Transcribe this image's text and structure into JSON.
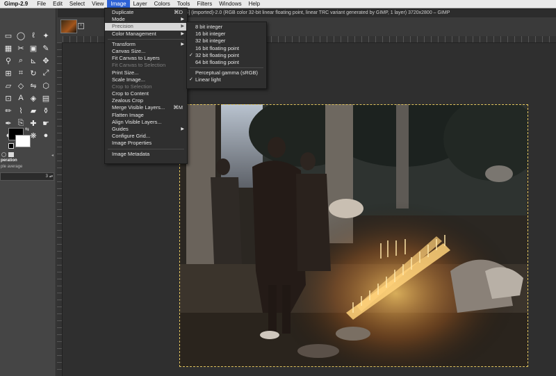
{
  "menubar": {
    "app_name": "Gimp-2.9",
    "items": [
      "File",
      "Edit",
      "Select",
      "View",
      "Image",
      "Layer",
      "Colors",
      "Tools",
      "Filters",
      "Windows",
      "Help"
    ],
    "active": "Image"
  },
  "window": {
    "title": "*[_5014835] (imported)-2.0 (RGB color 32-bit linear floating point, linear TRC variant generated by GIMP, 1 layer) 3720x2800 – GIMP"
  },
  "toolbox": {
    "tools": [
      "rect-select-icon",
      "ellipse-select-icon",
      "free-select-icon",
      "fuzzy-select-icon",
      "select-by-color-icon",
      "scissors-icon",
      "foreground-select-icon",
      "paths-icon",
      "color-picker-icon",
      "zoom-icon",
      "measure-icon",
      "move-icon",
      "align-icon",
      "crop-icon",
      "rotate-icon",
      "scale-icon",
      "shear-icon",
      "perspective-icon",
      "flip-icon",
      "cage-icon",
      "unified-transform-icon",
      "text-icon",
      "bucket-fill-icon",
      "blend-icon",
      "pencil-icon",
      "paintbrush-icon",
      "eraser-icon",
      "airbrush-icon",
      "ink-icon",
      "clone-icon",
      "heal-icon",
      "smudge-icon",
      "dodge-burn-icon",
      "mypaint-brush-icon",
      "warp-icon",
      "blur-icon"
    ],
    "options_title": "peration",
    "options_subtitle": "ple average",
    "options_field_value": "3"
  },
  "image_menu": {
    "items": [
      {
        "label": "Duplicate",
        "shortcut": "⌘D",
        "submenu": false,
        "disabled": false
      },
      {
        "label": "Mode",
        "shortcut": "",
        "submenu": true,
        "disabled": false
      },
      {
        "label": "Precision",
        "shortcut": "",
        "submenu": true,
        "disabled": false,
        "highlighted": true
      },
      {
        "label": "Color Management",
        "shortcut": "",
        "submenu": true,
        "disabled": false
      },
      {
        "sep": true
      },
      {
        "label": "Transform",
        "shortcut": "",
        "submenu": true,
        "disabled": false
      },
      {
        "label": "Canvas Size...",
        "shortcut": "",
        "submenu": false,
        "disabled": false
      },
      {
        "label": "Fit Canvas to Layers",
        "shortcut": "",
        "submenu": false,
        "disabled": false
      },
      {
        "label": "Fit Canvas to Selection",
        "shortcut": "",
        "submenu": false,
        "disabled": true
      },
      {
        "label": "Print Size...",
        "shortcut": "",
        "submenu": false,
        "disabled": false
      },
      {
        "label": "Scale Image...",
        "shortcut": "",
        "submenu": false,
        "disabled": false
      },
      {
        "label": "Crop to Selection",
        "shortcut": "",
        "submenu": false,
        "disabled": true
      },
      {
        "label": "Crop to Content",
        "shortcut": "",
        "submenu": false,
        "disabled": false
      },
      {
        "label": "Zealous Crop",
        "shortcut": "",
        "submenu": false,
        "disabled": false
      },
      {
        "label": "Merge Visible Layers...",
        "shortcut": "⌘M",
        "submenu": false,
        "disabled": false
      },
      {
        "label": "Flatten Image",
        "shortcut": "",
        "submenu": false,
        "disabled": false
      },
      {
        "label": "Align Visible Layers...",
        "shortcut": "",
        "submenu": false,
        "disabled": false
      },
      {
        "label": "Guides",
        "shortcut": "",
        "submenu": true,
        "disabled": false
      },
      {
        "label": "Configure Grid...",
        "shortcut": "",
        "submenu": false,
        "disabled": false
      },
      {
        "label": "Image Properties",
        "shortcut": "",
        "submenu": false,
        "disabled": false
      },
      {
        "sep": true
      },
      {
        "label": "Image Metadata",
        "shortcut": "",
        "submenu": false,
        "disabled": false
      }
    ]
  },
  "precision_menu": {
    "items": [
      {
        "label": "8 bit integer",
        "checked": false
      },
      {
        "label": "16 bit integer",
        "checked": false
      },
      {
        "label": "32 bit integer",
        "checked": false
      },
      {
        "label": "16 bit floating point",
        "checked": false
      },
      {
        "label": "32 bit floating point",
        "checked": true
      },
      {
        "label": "64 bit floating point",
        "checked": false
      },
      {
        "sep": true
      },
      {
        "label": "Perceptual gamma (sRGB)",
        "checked": false
      },
      {
        "label": "Linear light",
        "checked": true
      }
    ]
  },
  "colors": {
    "menu_bg": "#2f2f2f",
    "highlight": "#d8d8d8",
    "selection_border": "#e3c660",
    "menubar_active": "#2d62d6"
  }
}
